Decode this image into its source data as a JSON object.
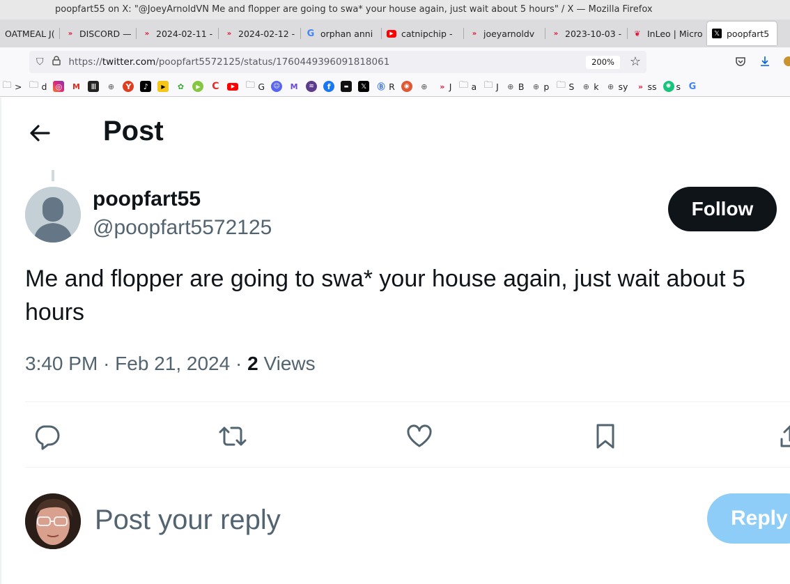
{
  "window": {
    "title": "poopfart55 on X: \"@JoeyArnoldVN Me and flopper are going to swa* your house again, just wait about 5 hours\" / X — Mozilla Firefox"
  },
  "tabs": [
    {
      "label": "OATMEAL J(",
      "icon": "none"
    },
    {
      "label": "DISCORD —",
      "icon": "hive-icon"
    },
    {
      "label": "2024-02-11 -",
      "icon": "hive-icon"
    },
    {
      "label": "2024-02-12 -",
      "icon": "hive-icon"
    },
    {
      "label": "orphan anni",
      "icon": "google-icon"
    },
    {
      "label": "catnipchip -",
      "icon": "youtube-icon"
    },
    {
      "label": "joeyarnoldv",
      "icon": "hive-icon"
    },
    {
      "label": "2023-10-03 -",
      "icon": "hive-icon"
    },
    {
      "label": "InLeo | Micro",
      "icon": "inleo-icon"
    },
    {
      "label": "poopfart5",
      "icon": "x-icon",
      "active": true
    }
  ],
  "navbar": {
    "url_scheme": "https://",
    "url_host": "twitter.com",
    "url_path": "/poopfart5572125/status/1760449396091818061",
    "zoom": "200%"
  },
  "bookmarks": [
    {
      "icon": "folder-icon",
      "label": ">"
    },
    {
      "icon": "folder-icon",
      "label": "d"
    },
    {
      "icon": "instagram-icon",
      "label": ""
    },
    {
      "icon": "gmail-icon",
      "label": ""
    },
    {
      "icon": "bank-icon",
      "label": ""
    },
    {
      "icon": "globe-icon",
      "label": ""
    },
    {
      "icon": "y-icon",
      "label": ""
    },
    {
      "icon": "tiktok-icon",
      "label": ""
    },
    {
      "icon": "video-icon",
      "label": ""
    },
    {
      "icon": "film-icon",
      "label": ""
    },
    {
      "icon": "rumble-icon",
      "label": ""
    },
    {
      "icon": "c-icon",
      "label": ""
    },
    {
      "icon": "youtube-icon",
      "label": ""
    },
    {
      "icon": "folder-icon",
      "label": "G"
    },
    {
      "icon": "discord-icon",
      "label": ""
    },
    {
      "icon": "m-icon",
      "label": ""
    },
    {
      "icon": "spotify-icon",
      "label": ""
    },
    {
      "icon": "facebook-icon",
      "label": ""
    },
    {
      "icon": "dark-icon",
      "label": ""
    },
    {
      "icon": "x-icon",
      "label": ""
    },
    {
      "icon": "r-icon",
      "label": "R"
    },
    {
      "icon": "duckduckgo-icon",
      "label": ""
    },
    {
      "icon": "globe-icon",
      "label": ""
    },
    {
      "icon": "hive-icon",
      "label": "J"
    },
    {
      "icon": "folder-icon",
      "label": "a"
    },
    {
      "icon": "folder-icon",
      "label": "J"
    },
    {
      "icon": "globe-icon",
      "label": "B"
    },
    {
      "icon": "globe-icon",
      "label": "p"
    },
    {
      "icon": "folder-icon",
      "label": "S"
    },
    {
      "icon": "globe-icon",
      "label": "k"
    },
    {
      "icon": "globe-icon",
      "label": "sy"
    },
    {
      "icon": "hive-icon",
      "label": "ss"
    },
    {
      "icon": "chatgpt-icon",
      "label": "s"
    },
    {
      "icon": "google-icon",
      "label": ""
    }
  ],
  "header": {
    "title": "Post"
  },
  "tweet": {
    "display_name": "poopfart55",
    "handle": "@poopfart5572125",
    "follow_label": "Follow",
    "text": "Me and flopper are going to swa* your house again, just wait about 5 hours",
    "time": "3:40 PM",
    "date": "Feb 21, 2024",
    "views_count": "2",
    "views_label": "Views",
    "sep": "·"
  },
  "reply": {
    "placeholder": "Post your reply",
    "button_label": "Reply"
  },
  "colors": {
    "primary_text": "#0f1419",
    "secondary_text": "#536471",
    "follow_bg": "#0f1419",
    "reply_button_bg": "#8ecdf7",
    "divider": "#eff3f4"
  }
}
